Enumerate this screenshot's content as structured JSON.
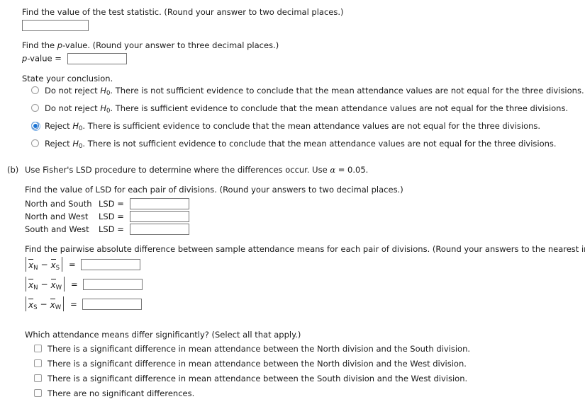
{
  "part_a": {
    "test_statistic_prompt": "Find the value of the test statistic. (Round your answer to two decimal places.)",
    "test_statistic_value": "",
    "pvalue_prompt_pre": "Find the ",
    "pvalue_prompt_italic": "p",
    "pvalue_prompt_post": "-value. (Round your answer to three decimal places.)",
    "pvalue_label_italic": "p",
    "pvalue_label_post": "-value =",
    "pvalue_value": "",
    "conclusion_prompt": "State your conclusion.",
    "conclusion_options": [
      {
        "pre": "Do not reject ",
        "symbol": "H",
        "subscript": "0",
        "post": ". There is not sufficient evidence to conclude that the mean attendance values are not equal for the three divisions.",
        "selected": false
      },
      {
        "pre": "Do not reject ",
        "symbol": "H",
        "subscript": "0",
        "post": ". There is sufficient evidence to conclude that the mean attendance values are not equal for the three divisions.",
        "selected": false
      },
      {
        "pre": "Reject ",
        "symbol": "H",
        "subscript": "0",
        "post": ". There is sufficient evidence to conclude that the mean attendance values are not equal for the three divisions.",
        "selected": true
      },
      {
        "pre": "Reject ",
        "symbol": "H",
        "subscript": "0",
        "post": ". There is not sufficient evidence to conclude that the mean attendance values are not equal for the three divisions.",
        "selected": false
      }
    ]
  },
  "part_b": {
    "label": "(b)",
    "intro_pre": "Use Fisher's LSD procedure to determine where the differences occur. Use ",
    "intro_alpha": "α",
    "intro_post": " = 0.05.",
    "lsd_prompt": "Find the value of LSD for each pair of divisions. (Round your answers to two decimal places.)",
    "lsd_rows": [
      {
        "pair": "North and South",
        "label": "LSD  =",
        "value": ""
      },
      {
        "pair": "North and West",
        "label": "LSD  =",
        "value": ""
      },
      {
        "pair": "South and West",
        "label": "LSD  =",
        "value": ""
      }
    ],
    "pairwise_prompt": "Find the pairwise absolute difference between sample attendance means for each pair of divisions. (Round your answers to the nearest integer.)",
    "pairwise_rows": [
      {
        "first_sub": "N",
        "second_sub": "S",
        "eq": "=",
        "value": ""
      },
      {
        "first_sub": "N",
        "second_sub": "W",
        "eq": "=",
        "value": ""
      },
      {
        "first_sub": "S",
        "second_sub": "W",
        "eq": "=",
        "value": ""
      }
    ],
    "which_prompt": "Which attendance means differ significantly? (Select all that apply.)",
    "which_options": [
      {
        "label": "There is a significant difference in mean attendance between the North division and the South division.",
        "checked": false
      },
      {
        "label": "There is a significant difference in mean attendance between the North division and the West division.",
        "checked": false
      },
      {
        "label": "There is a significant difference in mean attendance between the South division and the West division.",
        "checked": false
      },
      {
        "label": "There are no significant differences.",
        "checked": false
      }
    ]
  },
  "colors": {
    "accent": "#1a73d4",
    "text": "#1a1a1a",
    "border": "#767676"
  }
}
